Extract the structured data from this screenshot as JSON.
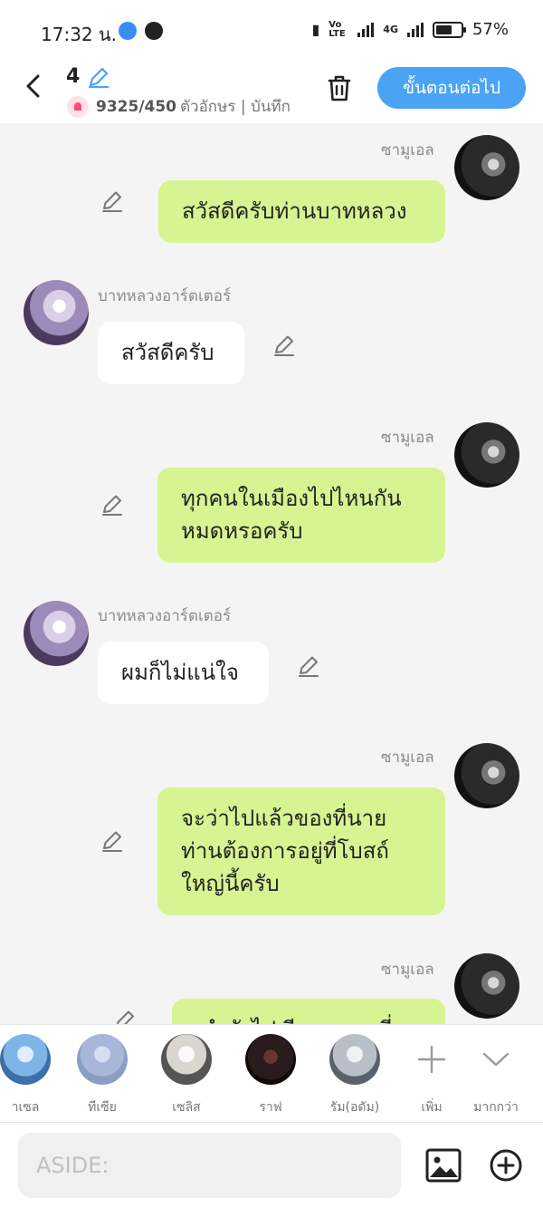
{
  "status_bar": {
    "time": "17:32 น.",
    "battery": "57%",
    "network_label": "Vo LTE",
    "net_type": "4G"
  },
  "header": {
    "episode_number": "4",
    "char_count": "9325/450",
    "meta_text": "ตัวอักษร | บันทึก",
    "next_button": "ขั้นตอนต่อไป"
  },
  "messages": [
    {
      "sender": "ซามูเอล",
      "side": "right",
      "text": [
        "สวัสดีครับท่านบาทหลวง"
      ]
    },
    {
      "sender": "บาทหลวงอาร์ตเตอร์",
      "side": "left",
      "text": [
        "สวัสดีครับ"
      ]
    },
    {
      "sender": "ซามูเอล",
      "side": "right",
      "text": [
        "ทุกคนในเมืองไปไหนกัน",
        "หมดหรอครับ"
      ]
    },
    {
      "sender": "บาทหลวงอาร์ตเตอร์",
      "side": "left",
      "text": [
        "ผมก็ไม่แน่ใจ"
      ]
    },
    {
      "sender": "ซามูเอล",
      "side": "right",
      "text": [
        "จะว่าไปแล้วของที่นาย",
        "ท่านต้องการอยู่ที่โบสถ์",
        "ใหญ่นี้ครับ"
      ]
    },
    {
      "sender": "ซามูเอล",
      "side": "right",
      "text": [
        "...ำลังไปเรียกทุกคนที่..."
      ]
    }
  ],
  "characters": [
    {
      "label": "าเซล",
      "color": "#7fb4e6"
    },
    {
      "label": "ทีเซีย",
      "color": "#a7b6d9"
    },
    {
      "label": "เซลิส",
      "color": "#d9d6d0"
    },
    {
      "label": "ราฟ",
      "color": "#2a1c1c"
    },
    {
      "label": "รัม(อดัม)",
      "color": "#b8bfc9"
    }
  ],
  "char_actions": {
    "add_label": "เพิ่ม",
    "more_label": "มากกว่า"
  },
  "input": {
    "placeholder": "ASIDE:"
  }
}
